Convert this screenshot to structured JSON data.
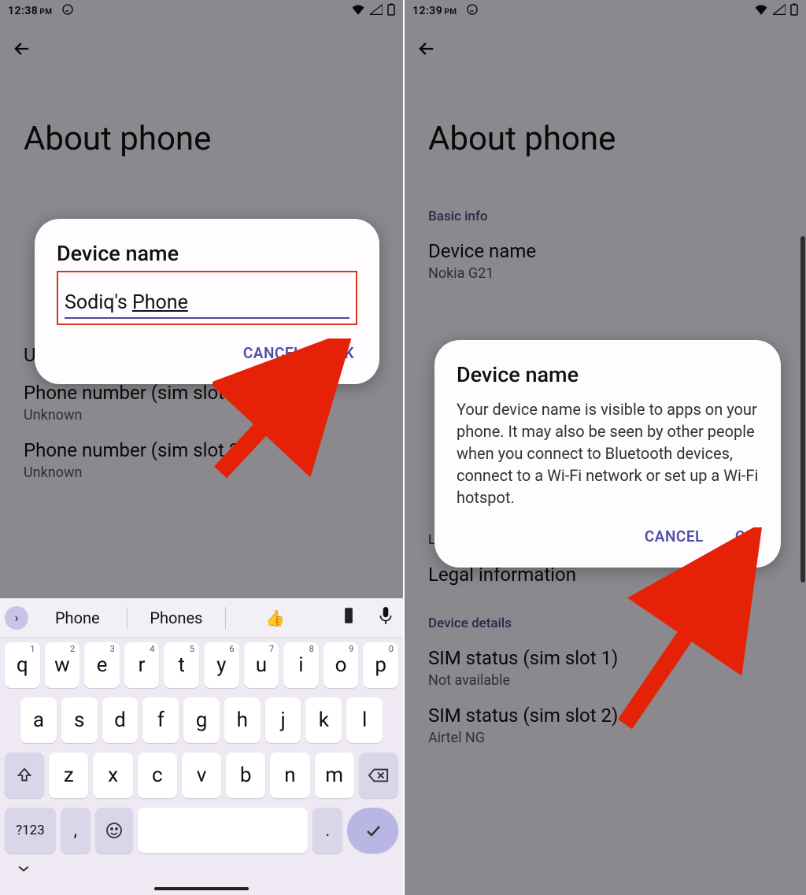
{
  "left": {
    "statusbar": {
      "time": "12:38",
      "ampm": "PM"
    },
    "title": "About phone",
    "dialog": {
      "title": "Device name",
      "input": "Sodiq's Phone",
      "cancel": "CANCEL",
      "ok": "OK"
    },
    "bg": {
      "uep": "User Experience Program",
      "pn1t": "Phone number (sim slot 1)",
      "pn1s": "Unknown",
      "pn2t": "Phone number (sim slot 2)",
      "pn2s": "Unknown"
    },
    "keyboard": {
      "suggest1": "Phone",
      "suggest2": "Phones",
      "row1": [
        "q",
        "w",
        "e",
        "r",
        "t",
        "y",
        "u",
        "i",
        "o",
        "p"
      ],
      "row1sup": [
        "1",
        "2",
        "3",
        "4",
        "5",
        "6",
        "7",
        "8",
        "9",
        "0"
      ],
      "row2": [
        "a",
        "s",
        "d",
        "f",
        "g",
        "h",
        "j",
        "k",
        "l"
      ],
      "row3": [
        "z",
        "x",
        "c",
        "v",
        "b",
        "n",
        "m"
      ],
      "numkey": "?123",
      "comma": ",",
      "period": "."
    }
  },
  "right": {
    "statusbar": {
      "time": "12:39",
      "ampm": "PM"
    },
    "title": "About phone",
    "sections": {
      "basic": "Basic info",
      "dnT": "Device name",
      "dnS": "Nokia G21",
      "legalLbl": "Legal & regulatory",
      "legalT": "Legal information",
      "devLbl": "Device details",
      "sim1t": "SIM status (sim slot 1)",
      "sim1s": "Not available",
      "sim2t": "SIM status (sim slot 2)",
      "sim2s": "Airtel NG"
    },
    "dialog": {
      "title": "Device name",
      "msg": "Your device name is visible to apps on your phone. It may also be seen by other people when you connect to Bluetooth devices, connect to a Wi-Fi network or set up a Wi-Fi hotspot.",
      "cancel": "CANCEL",
      "ok": "OK"
    }
  }
}
